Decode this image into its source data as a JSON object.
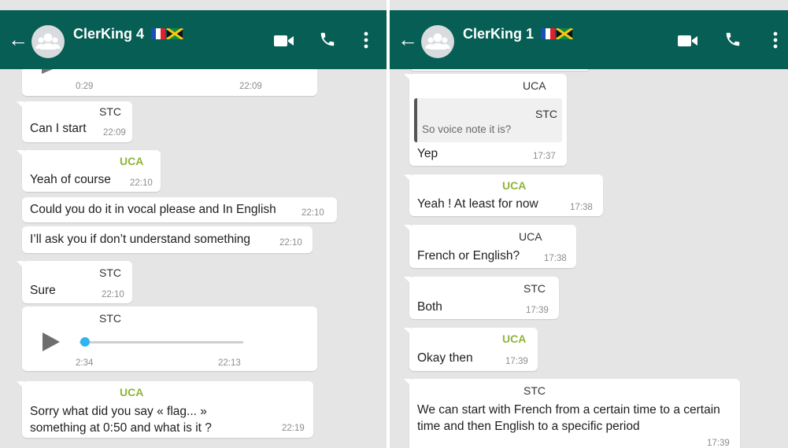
{
  "colors": {
    "header": "#075e54",
    "chat_bg": "#e5e5e5",
    "bubble": "#ffffff",
    "uca": "#8fb43a"
  },
  "left": {
    "title": "ClerKing 4",
    "messages": {
      "m0": {
        "duration": "0:29",
        "time": "22:09"
      },
      "m1": {
        "sender": "STC",
        "text": "Can I start",
        "time": "22:09"
      },
      "m2": {
        "sender": "UCA",
        "text": "Yeah of course",
        "time": "22:10"
      },
      "m3": {
        "text": "Could you do it in vocal please and In English",
        "time": "22:10"
      },
      "m4": {
        "text": "I’ll ask you if don’t understand something",
        "time": "22:10"
      },
      "m5": {
        "sender": "STC",
        "text": "Sure",
        "time": "22:10"
      },
      "m6": {
        "sender": "STC",
        "duration": "2:34",
        "time": "22:13",
        "progress": 0.02
      },
      "m7": {
        "sender": "UCA",
        "text": "Sorry what did you say « flag... » something at 0:50 and what is it ?",
        "time": "22:19"
      }
    }
  },
  "right": {
    "title": "ClerKing 1",
    "messages": {
      "m1": {
        "sender": "UCA",
        "quote_sender": "STC",
        "quote_text": "So voice note it is?",
        "text": "Yep",
        "time": "17:37"
      },
      "m2": {
        "sender": "UCA",
        "text": "Yeah ! At least for now",
        "time": "17:38"
      },
      "m3": {
        "sender": "UCA",
        "text": "French or English?",
        "time": "17:38"
      },
      "m4": {
        "sender": "STC",
        "text": "Both",
        "time": "17:39"
      },
      "m5": {
        "sender": "UCA",
        "text": "Okay then",
        "time": "17:39"
      },
      "m6": {
        "sender": "STC",
        "text": "We can start with French from a certain time to a certain time and then English to a specific period",
        "time": "17:39"
      }
    }
  },
  "icons": {
    "back": "back-arrow-icon",
    "avatar": "group-avatar-icon",
    "flags": "flags-icon",
    "video": "video-call-icon",
    "call": "phone-icon",
    "menu": "more-options-icon",
    "play": "play-icon",
    "mic": "microphone-icon"
  }
}
